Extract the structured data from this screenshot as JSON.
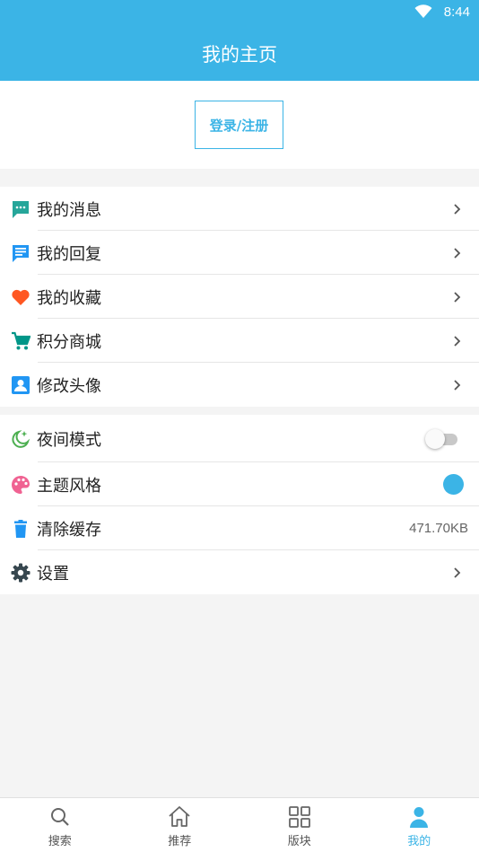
{
  "status_bar": {
    "time": "8:44",
    "wifi_icon": "wifi-icon"
  },
  "header": {
    "title": "我的主页"
  },
  "login": {
    "label": "登录/注册"
  },
  "menu_group_1": [
    {
      "label": "我的消息",
      "icon": "message-icon",
      "icon_color": "#26a69a"
    },
    {
      "label": "我的回复",
      "icon": "reply-icon",
      "icon_color": "#2196f3"
    },
    {
      "label": "我的收藏",
      "icon": "heart-icon",
      "icon_color": "#ff5722"
    },
    {
      "label": "积分商城",
      "icon": "cart-icon",
      "icon_color": "#009688"
    },
    {
      "label": "修改头像",
      "icon": "avatar-icon",
      "icon_color": "#2196f3"
    }
  ],
  "menu_group_2": [
    {
      "label": "夜间模式",
      "icon": "night-mode-icon",
      "icon_color": "#4caf50",
      "toggle_on": false
    },
    {
      "label": "主题风格",
      "icon": "palette-icon",
      "icon_color": "#f06292",
      "theme_color": "#3bb4e6"
    },
    {
      "label": "清除缓存",
      "icon": "trash-icon",
      "icon_color": "#2196f3",
      "value": "471.70KB"
    },
    {
      "label": "设置",
      "icon": "gear-icon",
      "icon_color": "#37474f"
    }
  ],
  "bottom_nav": [
    {
      "label": "搜索",
      "icon": "search-icon",
      "active": false
    },
    {
      "label": "推荐",
      "icon": "home-icon",
      "active": false
    },
    {
      "label": "版块",
      "icon": "grid-icon",
      "active": false
    },
    {
      "label": "我的",
      "icon": "person-icon",
      "active": true
    }
  ],
  "colors": {
    "accent": "#3bb4e6",
    "background": "#f4f4f4"
  }
}
